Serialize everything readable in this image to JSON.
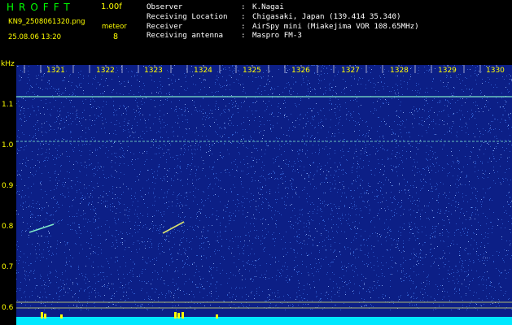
{
  "header": {
    "app_title": "HROFFT",
    "version": "1.00f",
    "file_name": "KN9_2508061320.png",
    "mode": "meteor",
    "datetime": "25.08.06 13:20",
    "count": "8"
  },
  "info": [
    {
      "key": "Observer",
      "sep": ":",
      "value": "K.Nagai"
    },
    {
      "key": "Receiving Location",
      "sep": ":",
      "value": "Chigasaki, Japan (139.414 35.340)"
    },
    {
      "key": "Receiver",
      "sep": ":",
      "value": "AirSpy mini (Miakejima VOR 108.65MHz)"
    },
    {
      "key": "Receiving antenna",
      "sep": ":",
      "value": "Maspro FM-3"
    }
  ],
  "spectrogram": {
    "y_unit": "kHz",
    "y_ticks": [
      "1.1",
      "1.0",
      "0.9",
      "0.8",
      "0.7",
      "0.6"
    ],
    "x_ticks": [
      "1321",
      "1322",
      "1323",
      "1324",
      "1325",
      "1326",
      "1327",
      "1328",
      "1329",
      "1330"
    ],
    "colors": {
      "background": "#0c1f86",
      "noise": "#3a6fe0",
      "carrier": "#7fe8c8",
      "echo": "#d8e070",
      "baseline": "#00e8ff",
      "spike": "#ffff00"
    }
  }
}
